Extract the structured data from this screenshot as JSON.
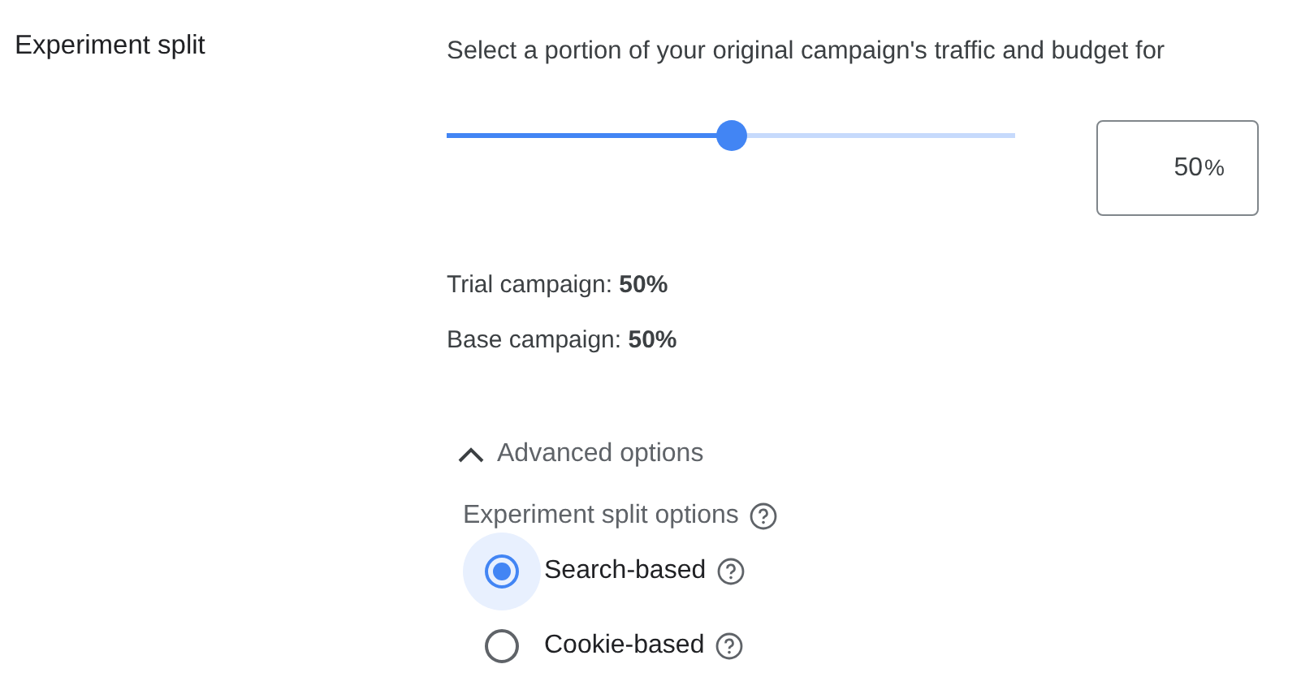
{
  "section_label": "Experiment split",
  "description": "Select a portion of your original campaign's traffic and budget for",
  "split_slider": {
    "level": 0.5
  },
  "split_field": {
    "value": "50",
    "suffix": "%"
  },
  "summary": [
    "Trial campaign: **50%**",
    "Base campaign: **50%**"
  ],
  "advanced": {
    "label": "Advanced options",
    "expanded": true
  },
  "split_options": {
    "label": "Experiment split options",
    "options": [
      {
        "label": "Search-based",
        "selected": true
      },
      {
        "label": "Cookie-based",
        "selected": false
      }
    ]
  }
}
